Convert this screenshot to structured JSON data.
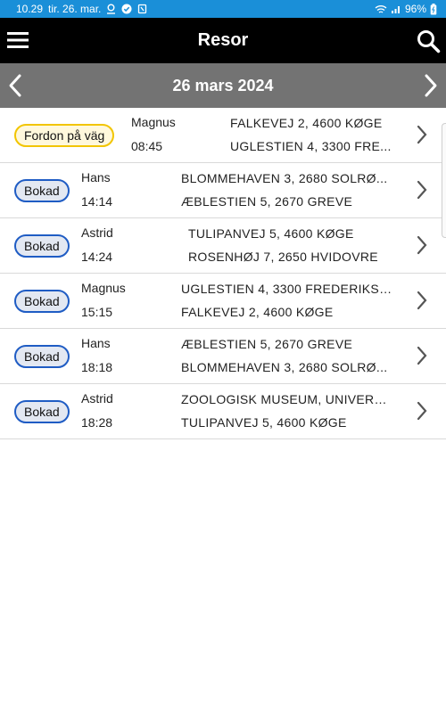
{
  "status_bar": {
    "time": "10.29",
    "date": "tir. 26. mar.",
    "battery": "96%",
    "icons": [
      "location-icon",
      "check-circle-icon",
      "sync-icon",
      "wifi-icon",
      "signal-icon",
      "battery-icon"
    ]
  },
  "header": {
    "title": "Resor"
  },
  "date_nav": {
    "date": "26 mars 2024"
  },
  "trips": [
    {
      "status": "Fordon på väg",
      "status_type": "on-way",
      "name": "Magnus",
      "time": "08:45",
      "from": "FALKEVEJ 2, 4600 KØGE",
      "to": "UGLESTIEN 4, 3300 FRE..."
    },
    {
      "status": "Bokad",
      "status_type": "booked",
      "name": "Hans",
      "time": "14:14",
      "from": "BLOMMEHAVEN 3, 2680 SOLRØ...",
      "to": "ÆBLESTIEN 5, 2670 GREVE"
    },
    {
      "status": "Bokad",
      "status_type": "booked",
      "name": "Astrid",
      "time": "14:24",
      "from": "TULIPANVEJ 5, 4600 KØGE",
      "to": "ROSENHØJ 7, 2650 HVIDOVRE"
    },
    {
      "status": "Bokad",
      "status_type": "booked",
      "name": "Magnus",
      "time": "15:15",
      "from": "UGLESTIEN 4, 3300 FREDERIKSV...",
      "to": "FALKEVEJ 2, 4600 KØGE"
    },
    {
      "status": "Bokad",
      "status_type": "booked",
      "name": "Hans",
      "time": "18:18",
      "from": "ÆBLESTIEN 5, 2670 GREVE",
      "to": "BLOMMEHAVEN 3, 2680 SOLRØ..."
    },
    {
      "status": "Bokad",
      "status_type": "booked",
      "name": "Astrid",
      "time": "18:28",
      "from": "ZOOLOGISK MUSEUM, UNIVERSI...",
      "to": "TULIPANVEJ 5, 4600 KØGE"
    }
  ],
  "colors": {
    "status_bar": "#1a8fd8",
    "app_bar": "#000000",
    "date_bar": "#737373",
    "badge_on_way_border": "#f2c500",
    "badge_booked_border": "#1f5cc4"
  }
}
